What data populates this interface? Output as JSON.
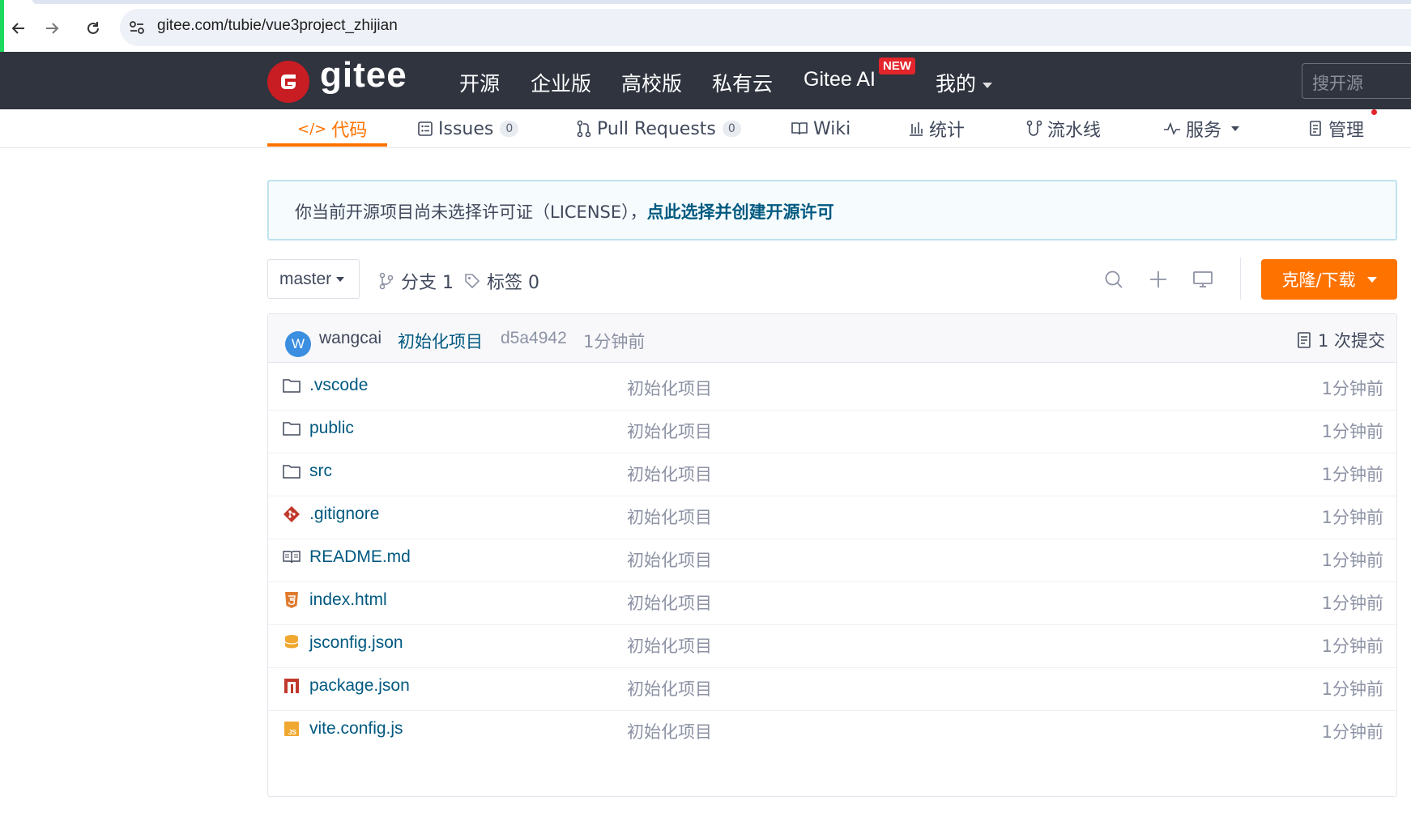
{
  "browser": {
    "url": "gitee.com/tubie/vue3project_zhijian"
  },
  "header": {
    "logo_text": "gitee",
    "nav": [
      "开源",
      "企业版",
      "高校版",
      "私有云",
      "Gitee AI",
      "我的"
    ],
    "new_badge": "NEW",
    "search_placeholder": "搜开源"
  },
  "tabs": [
    {
      "label": "代码",
      "icon": "code-icon",
      "active": true
    },
    {
      "label": "Issues",
      "icon": "issues-icon",
      "count": "0"
    },
    {
      "label": "Pull Requests",
      "icon": "pull-request-icon",
      "count": "0"
    },
    {
      "label": "Wiki",
      "icon": "wiki-icon"
    },
    {
      "label": "统计",
      "icon": "stats-icon"
    },
    {
      "label": "流水线",
      "icon": "pipeline-icon"
    },
    {
      "label": "服务",
      "icon": "service-icon"
    },
    {
      "label": "管理",
      "icon": "manage-icon"
    }
  ],
  "notice": {
    "text": "你当前开源项目尚未选择许可证（LICENSE），",
    "link": "点此选择并创建开源许可"
  },
  "repo_bar": {
    "branch": "master",
    "branches_label": "分支 1",
    "tags_label": "标签 0",
    "clone_label": "克隆/下载"
  },
  "commit": {
    "avatar_letter": "W",
    "author": "wangcai",
    "message": "初始化项目",
    "sha": "d5a4942",
    "time": "1分钟前",
    "count_label": "1 次提交"
  },
  "files": [
    {
      "name": ".vscode",
      "type": "folder",
      "message": "初始化项目",
      "time": "1分钟前"
    },
    {
      "name": "public",
      "type": "folder",
      "message": "初始化项目",
      "time": "1分钟前"
    },
    {
      "name": "src",
      "type": "folder",
      "message": "初始化项目",
      "time": "1分钟前"
    },
    {
      "name": ".gitignore",
      "type": "git",
      "message": "初始化项目",
      "time": "1分钟前"
    },
    {
      "name": "README.md",
      "type": "readme",
      "message": "初始化项目",
      "time": "1分钟前"
    },
    {
      "name": "index.html",
      "type": "html",
      "message": "初始化项目",
      "time": "1分钟前"
    },
    {
      "name": "jsconfig.json",
      "type": "json",
      "message": "初始化项目",
      "time": "1分钟前"
    },
    {
      "name": "package.json",
      "type": "npm",
      "message": "初始化项目",
      "time": "1分钟前"
    },
    {
      "name": "vite.config.js",
      "type": "js",
      "message": "初始化项目",
      "time": "1分钟前"
    }
  ],
  "colors": {
    "accent": "#fe7300",
    "header_bg": "#2f343f",
    "link": "#005980",
    "brand_red": "#c71d23"
  }
}
